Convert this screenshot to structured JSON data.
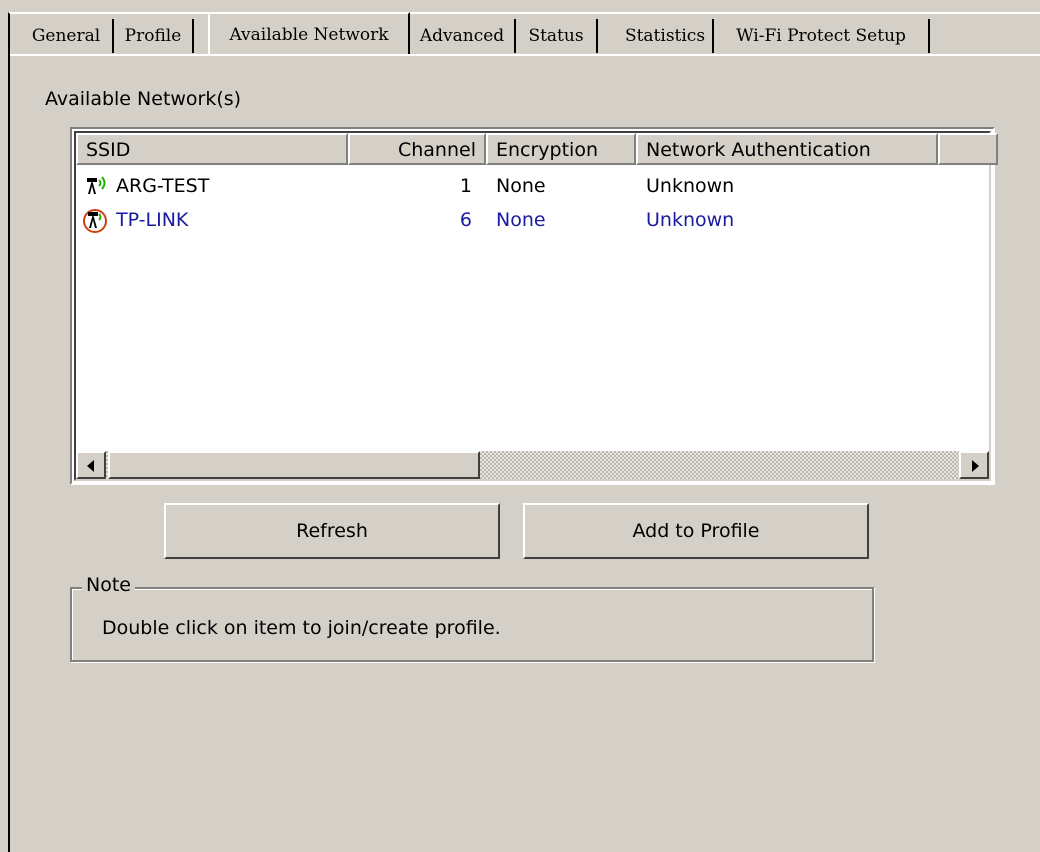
{
  "tabs": [
    {
      "label": "General",
      "active": false
    },
    {
      "label": "Profile",
      "active": false
    },
    {
      "label": "Available Network",
      "active": true
    },
    {
      "label": "Advanced",
      "active": false
    },
    {
      "label": "Status",
      "active": false
    },
    {
      "label": "Statistics",
      "active": false
    },
    {
      "label": "Wi-Fi Protect Setup",
      "active": false
    }
  ],
  "section_title": "Available Network(s)",
  "table": {
    "columns": [
      "SSID",
      "Channel",
      "Encryption",
      "Network Authentication"
    ],
    "rows": [
      {
        "ssid": "ARG-TEST",
        "channel": "1",
        "encryption": "None",
        "auth": "Unknown",
        "icon": "wifi-signal-icon",
        "selected": false
      },
      {
        "ssid": "TP-LINK",
        "channel": "6",
        "encryption": "None",
        "auth": "Unknown",
        "icon": "wifi-signal-connected-icon",
        "selected": true
      }
    ]
  },
  "buttons": {
    "refresh": "Refresh",
    "add_to_profile": "Add to Profile"
  },
  "note": {
    "legend": "Note",
    "text": "Double click on item to join/create profile."
  },
  "colors": {
    "window_bg": "#d4d0c8",
    "selected_row_text": "#1a1aa0",
    "signal_green": "#22b000"
  }
}
